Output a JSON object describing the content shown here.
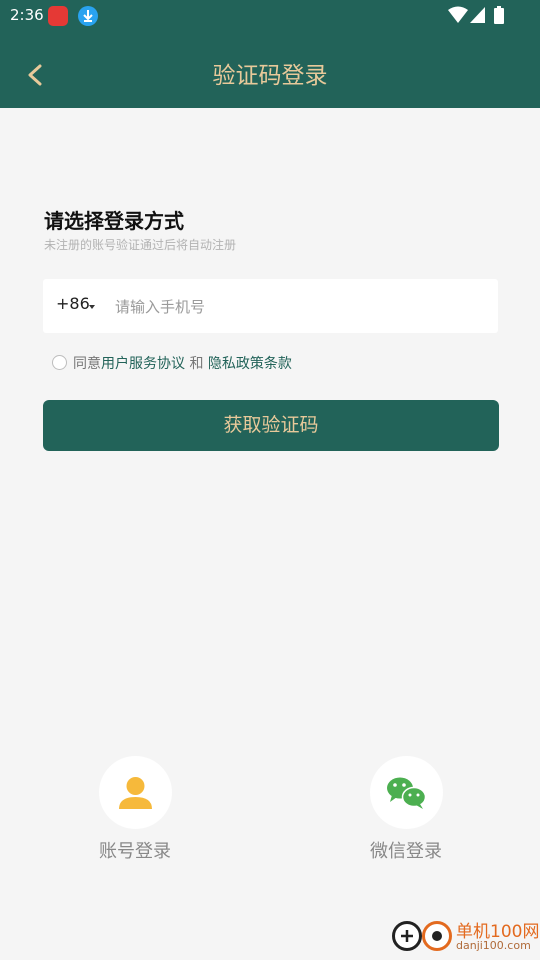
{
  "status_bar": {
    "time": "2:36"
  },
  "header": {
    "title": "验证码登录"
  },
  "login": {
    "heading": "请选择登录方式",
    "subheading": "未注册的账号验证通过后将自动注册",
    "country_code": "+86",
    "phone_placeholder": "请输入手机号",
    "agreement": {
      "prefix": "同意",
      "user_agreement": "用户服务协议",
      "and": "和",
      "privacy_policy": "隐私政策条款"
    },
    "get_code_label": "获取验证码"
  },
  "alt_logins": {
    "account_label": "账号登录",
    "wechat_label": "微信登录"
  },
  "watermark": {
    "name": "单机100网",
    "url": "danji100.com"
  },
  "colors": {
    "primary": "#226359",
    "gold": "#e8c99a",
    "background": "#f5f5f5"
  }
}
